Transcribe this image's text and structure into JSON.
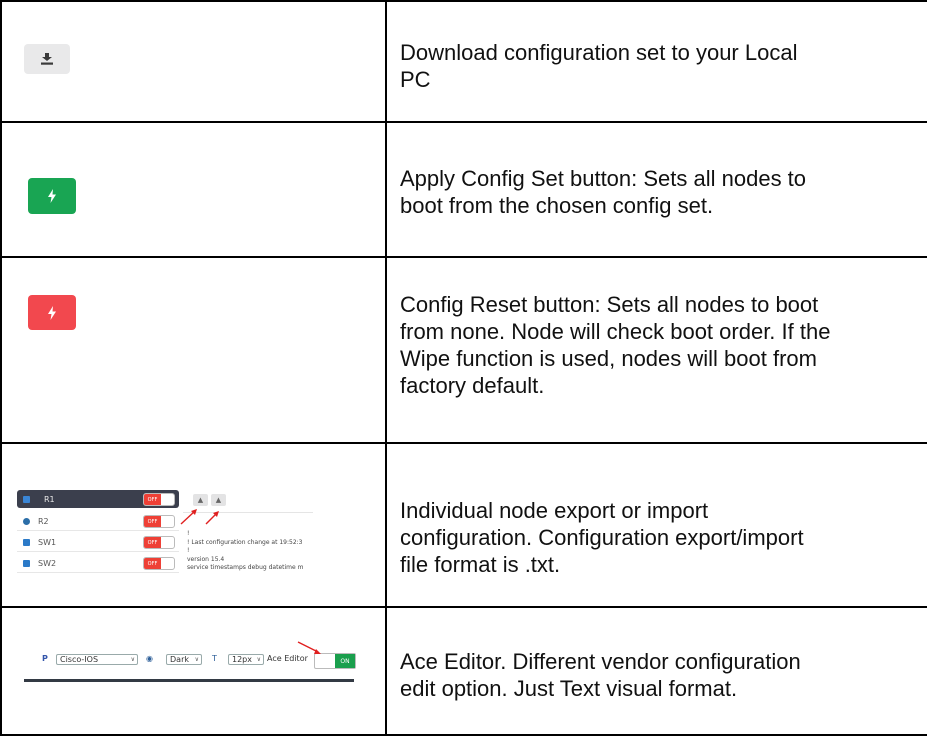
{
  "rows": [
    {
      "icon": "download-icon",
      "description": "Download configuration set to your Local\nPC"
    },
    {
      "icon": "lightning-icon",
      "color": "#19a553",
      "description": "Apply Config Set button: Sets all nodes to\nboot from the chosen config set."
    },
    {
      "icon": "lightning-icon",
      "color": "#f2484e",
      "description": "Config Reset button: Sets all nodes to boot\nfrom none. Node will check boot order. If the\nWipe function is used, nodes will boot from\nfactory default."
    },
    {
      "description": "Individual node export or import\nconfiguration. Configuration export/import\nfile format is .txt."
    },
    {
      "description": "Ace Editor. Different vendor configuration\nedit option. Just Text visual format."
    }
  ],
  "node_panel": {
    "nodes": [
      {
        "name": "R1",
        "toggle": "OFF",
        "selected": true
      },
      {
        "name": "R2",
        "toggle": "OFF",
        "selected": false
      },
      {
        "name": "SW1",
        "toggle": "OFF",
        "selected": false
      },
      {
        "name": "SW2",
        "toggle": "OFF",
        "selected": false
      }
    ],
    "config_lines": "!\n! Last configuration change at 19:52:3\n!\nversion 15.4\nservice timestamps debug datetime m"
  },
  "editor_toolbar": {
    "vendor": "Cisco-IOS",
    "theme": "Dark",
    "font_size": "12px",
    "ace_label": "Ace Editor",
    "ace_toggle": "ON"
  }
}
